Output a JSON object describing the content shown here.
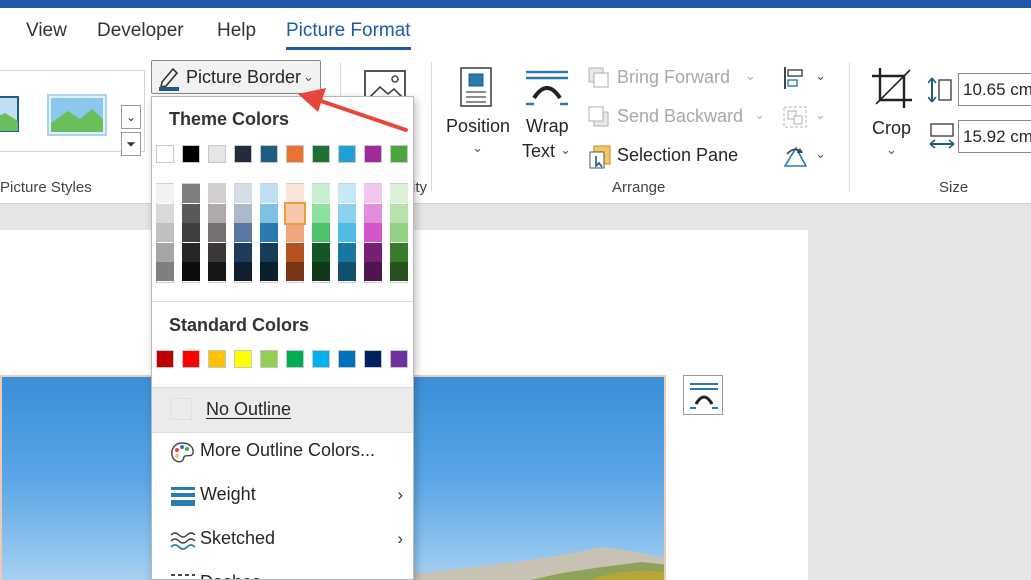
{
  "tabs": [
    {
      "label": "View"
    },
    {
      "label": "Developer"
    },
    {
      "label": "Help"
    },
    {
      "label": "Picture Format"
    }
  ],
  "ribbon": {
    "picture_border_label": "Picture Border",
    "picture_styles_label": "Picture Styles",
    "accessibility_label_partial": "ity",
    "position_label": "Position",
    "wrap_text_label_1": "Wrap",
    "wrap_text_label_2": "Text",
    "bring_forward_label": "Bring Forward",
    "send_backward_label": "Send Backward",
    "selection_pane_label": "Selection Pane",
    "arrange_label": "Arrange",
    "crop_label": "Crop",
    "height_value": "10.65 cm",
    "width_value": "15.92 cm",
    "size_label": "Size"
  },
  "menu": {
    "theme_colors_heading": "Theme Colors",
    "standard_colors_heading": "Standard Colors",
    "theme_colors": [
      "#ffffff",
      "#000000",
      "#e7e6e6",
      "#1f2d3d",
      "#1f5c82",
      "#e87332",
      "#1d7232",
      "#1fa0d6",
      "#a02a9a",
      "#4ba63b"
    ],
    "theme_shades": [
      [
        "#f2f2f2",
        "#d9d9d9",
        "#bfbfbf",
        "#a6a6a6",
        "#7f7f7f"
      ],
      [
        "#7f7f7f",
        "#595959",
        "#3f3f3f",
        "#262626",
        "#0d0d0d"
      ],
      [
        "#d0cece",
        "#aeaaaa",
        "#757171",
        "#3a3838",
        "#171616"
      ],
      [
        "#d6dce5",
        "#adb9ca",
        "#5b78a0",
        "#1f3b5a",
        "#0f1f30"
      ],
      [
        "#bfe0f2",
        "#80c0e5",
        "#2b7ab0",
        "#153d58",
        "#0a1f2c"
      ],
      [
        "#fbe3d6",
        "#f6c6ad",
        "#f0a67f",
        "#b6521e",
        "#793614"
      ],
      [
        "#c7efcf",
        "#8fdf9f",
        "#4cc36a",
        "#155625",
        "#0e3918"
      ],
      [
        "#c5e8f7",
        "#8bd1ef",
        "#4fbbe7",
        "#16789f",
        "#0f506a"
      ],
      [
        "#f1c5ed",
        "#e28ddb",
        "#d255c9",
        "#781f73",
        "#50154d"
      ],
      [
        "#dbf0d6",
        "#b7e1ad",
        "#93d284",
        "#387c2c",
        "#25531d"
      ]
    ],
    "standard_colors": [
      "#c00000",
      "#ff0000",
      "#ffc000",
      "#ffff00",
      "#92d050",
      "#00b050",
      "#00b0f0",
      "#0070c0",
      "#002060",
      "#7030a0"
    ],
    "no_outline_label": "No Outline",
    "more_colors_label": "More Outline Colors...",
    "weight_label": "Weight",
    "sketched_label": "Sketched",
    "dashes_label": "Dashes",
    "submenu_arrow": "›"
  },
  "colors": {
    "accent": "#1e5aa8",
    "annotation_arrow": "#e8453c"
  }
}
